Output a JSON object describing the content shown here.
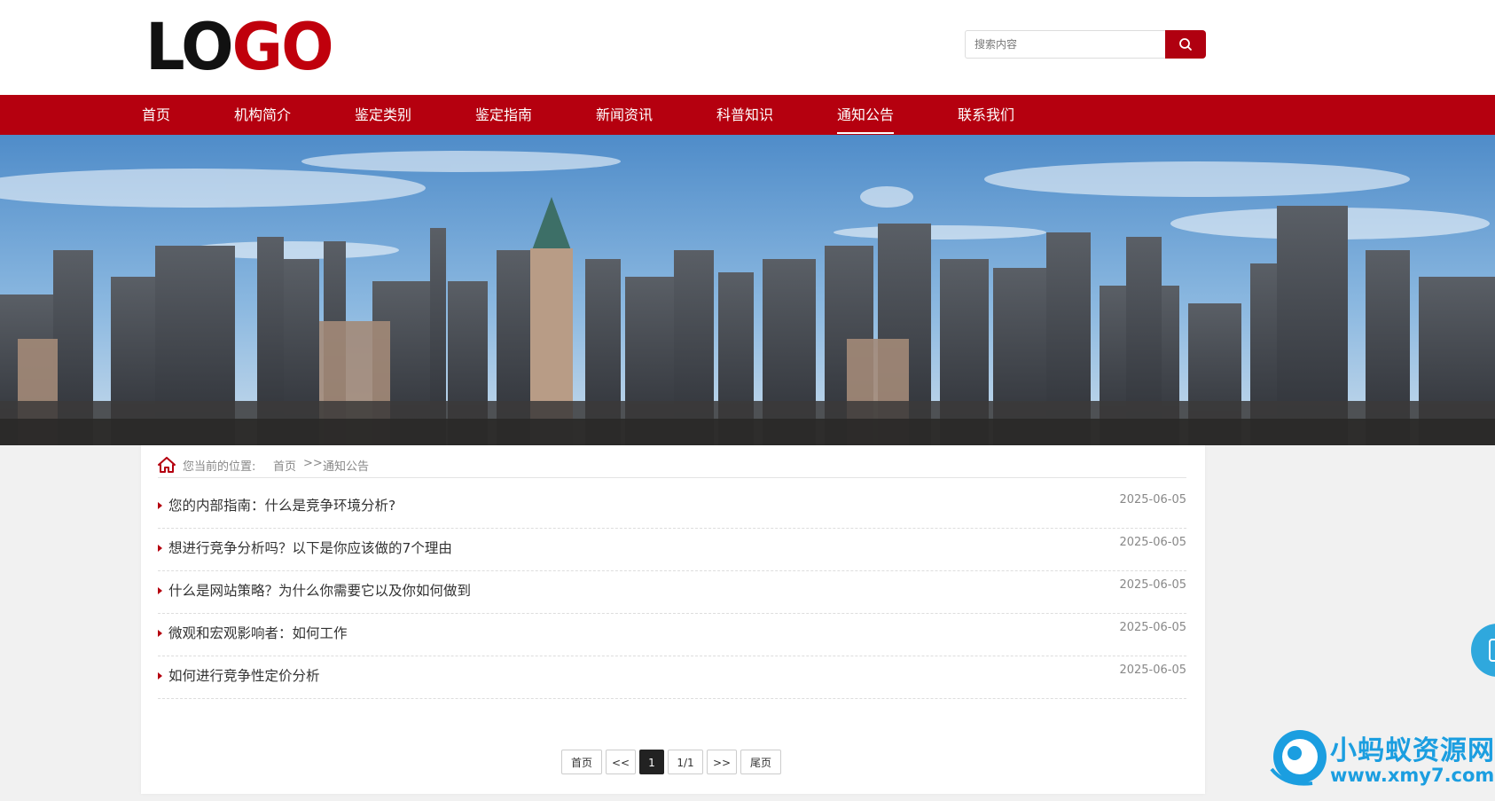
{
  "header": {
    "logo_part1": "LO",
    "logo_part2": "GO",
    "search_placeholder": "搜索内容",
    "search_icon": "search-icon"
  },
  "nav": {
    "items": [
      {
        "label": "首页"
      },
      {
        "label": "机构简介"
      },
      {
        "label": "鉴定类别"
      },
      {
        "label": "鉴定指南"
      },
      {
        "label": "新闻资讯"
      },
      {
        "label": "科普知识"
      },
      {
        "label": "通知公告",
        "active": true
      },
      {
        "label": "联系我们"
      }
    ]
  },
  "banner": {
    "description_icon": "city-skyline-image"
  },
  "breadcrumb": {
    "prefix": "您当前的位置:",
    "home": "首页",
    "separator": ">>",
    "current": "通知公告"
  },
  "articles": [
    {
      "title": "您的内部指南：什么是竞争环境分析?",
      "date": "2025-06-05"
    },
    {
      "title": "想进行竞争分析吗？以下是你应该做的7个理由",
      "date": "2025-06-05"
    },
    {
      "title": "什么是网站策略？为什么你需要它以及你如何做到",
      "date": "2025-06-05"
    },
    {
      "title": "微观和宏观影响者：如何工作",
      "date": "2025-06-05"
    },
    {
      "title": "如何进行竞争性定价分析",
      "date": "2025-06-05"
    }
  ],
  "pagination": {
    "first": "首页",
    "prev": "<<",
    "current": "1",
    "total": "1/1",
    "next": ">>",
    "last": "尾页"
  },
  "watermark": {
    "title": "小蚂蚁资源网",
    "url": "www.xmy7.com"
  },
  "colors": {
    "brand_red": "#b5000f",
    "accent_blue": "#1b9ee0"
  }
}
